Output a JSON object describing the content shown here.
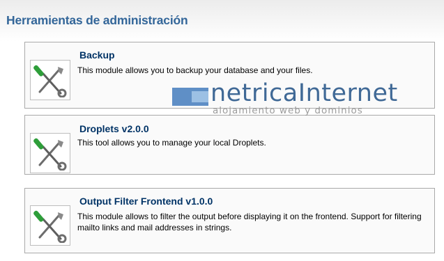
{
  "page": {
    "title": "Herramientas de administración"
  },
  "modules": [
    {
      "title": "Backup",
      "description": "This module allows you to backup your database and your files.",
      "icon": "tools-icon"
    },
    {
      "title": "Droplets v2.0.0",
      "description": "This tool allows you to manage your local Droplets.",
      "icon": "tools-icon"
    },
    {
      "title": "Output Filter Frontend v1.0.0",
      "description": "This module allows to filter the output before displaying it on the frontend. Support for filtering mailto links and mail addresses in strings.",
      "icon": "tools-icon"
    }
  ],
  "watermark": {
    "brand": "netricaInternet",
    "tagline": "alojamiento web y dominios"
  },
  "colors": {
    "title": "#336699",
    "module_title": "#003366",
    "card_border": "#a9a9a9",
    "card_bg": "#fafafa",
    "wrench_handle": "#2e9e3a",
    "watermark_blue": "#2c5a8c"
  }
}
